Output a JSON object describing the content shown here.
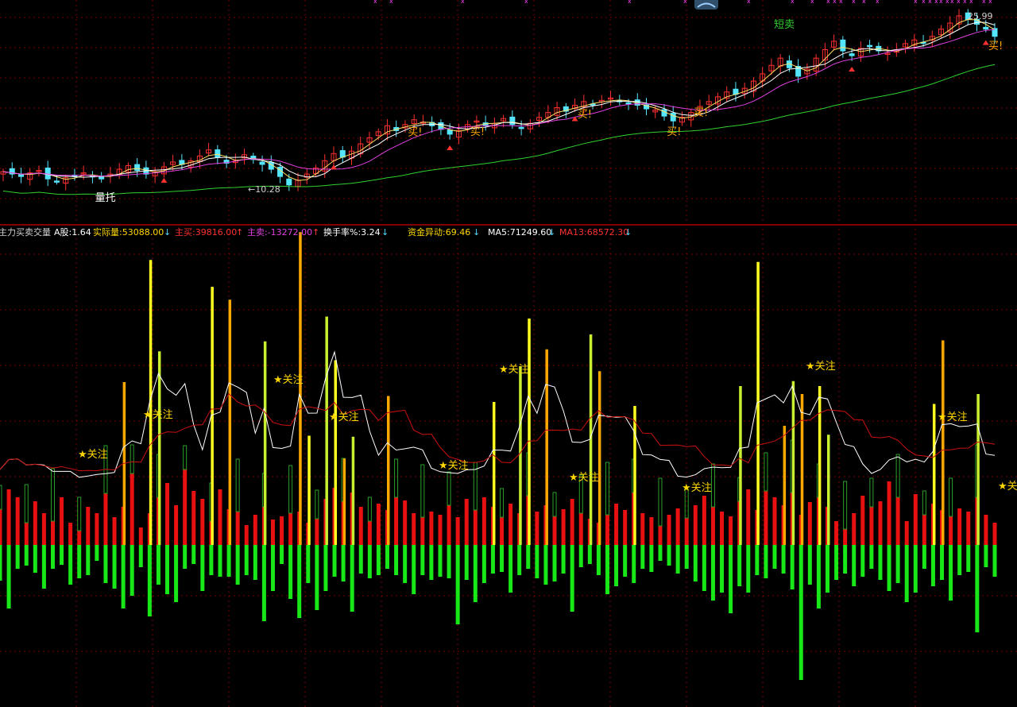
{
  "colors": {
    "background": "#000000",
    "grid": "#7a0000",
    "panel_border": "#b00000",
    "up_candle": "#ff3030",
    "down_candle": "#55e6ff",
    "ma_yellow": "#ffe066",
    "ma_white": "#ffffff",
    "ma_magenta": "#e040e0",
    "ma_green": "#30d030",
    "main_buy_red": "#e81010",
    "main_sell_green": "#18e818",
    "highlight_orange": "#ffa800",
    "highlight_yellow": "#ffff20",
    "highlight_green_yellow": "#c8f030",
    "signal_text": "#ffd700"
  },
  "top_panel": {
    "low_annotation": "←10.28",
    "high_annotation": "25.99",
    "labels": [
      {
        "text": "量托",
        "color": "#ffffff"
      },
      {
        "text": "买!",
        "color": "#ffa800"
      },
      {
        "text": "买!",
        "color": "#ffa800"
      },
      {
        "text": "买!",
        "color": "#ffa800"
      },
      {
        "text": "买!",
        "color": "#ffa800"
      },
      {
        "text": "买!",
        "color": "#ffa800"
      },
      {
        "text": "短卖",
        "color": "#30d030"
      },
      {
        "text": "买!",
        "color": "#ffa800"
      }
    ]
  },
  "indicator_bar": {
    "title": "主力买卖交量",
    "a_share": "A股:1.64",
    "actual_volume": "实际量:53088.00",
    "main_buy": "主买:39816.00",
    "main_sell": "主卖:-13272.00",
    "turnover": "换手率%:3.24",
    "capital_move": "资金异动:69.46",
    "ma5": "MA5:71249.60",
    "ma13": "MA13:68572.30"
  },
  "signal_label": "★关注",
  "chart_data": [
    {
      "type": "candlestick",
      "name": "price",
      "low_label": 10.28,
      "high_label": 25.99,
      "close": [
        13.0,
        12.8,
        12.6,
        12.9,
        13.1,
        12.4,
        12.2,
        12.5,
        12.7,
        12.9,
        12.6,
        12.4,
        12.8,
        13.2,
        13.5,
        13.1,
        12.8,
        13.0,
        13.4,
        13.8,
        13.6,
        13.9,
        14.3,
        14.8,
        14.2,
        13.7,
        13.9,
        14.4,
        14.0,
        13.6,
        13.2,
        12.6,
        11.9,
        12.3,
        12.8,
        13.3,
        13.9,
        14.5,
        14.2,
        14.7,
        15.3,
        15.8,
        16.3,
        16.8,
        16.4,
        16.9,
        17.3,
        17.1,
        16.8,
        16.5,
        16.1,
        16.4,
        16.9,
        17.2,
        16.8,
        17.0,
        17.4,
        16.9,
        16.6,
        17.0,
        17.5,
        17.9,
        18.3,
        18.0,
        18.5,
        18.8,
        18.6,
        18.9,
        19.1,
        18.8,
        18.7,
        18.5,
        18.2,
        18.1,
        17.6,
        17.2,
        17.5,
        17.9,
        18.4,
        18.8,
        19.2,
        19.6,
        19.4,
        19.9,
        20.5,
        21.1,
        21.8,
        22.4,
        21.6,
        20.9,
        21.5,
        22.4,
        23.1,
        23.8,
        23.0,
        22.6,
        23.2,
        23.4,
        23.0,
        22.8,
        23.1,
        23.6,
        23.9,
        23.7,
        24.2,
        24.8,
        25.3,
        25.9,
        25.6,
        25.2,
        24.8,
        24.2
      ],
      "ma_lines": [
        {
          "color": "#ffe066"
        },
        {
          "color": "#ffffff"
        },
        {
          "color": "#e040e0"
        },
        {
          "color": "#30d030"
        }
      ]
    },
    {
      "type": "bar",
      "name": "主力买卖交量",
      "main_buy": [
        45,
        70,
        60,
        28,
        55,
        40,
        30,
        60,
        28,
        18,
        48,
        40,
        65,
        35,
        48,
        90,
        22,
        40,
        60,
        78,
        50,
        95,
        68,
        58,
        30,
        70,
        45,
        42,
        25,
        38,
        48,
        32,
        36,
        40,
        42,
        28,
        33,
        58,
        72,
        55,
        66,
        48,
        30,
        52,
        44,
        60,
        56,
        40,
        35,
        42,
        38,
        50,
        35,
        58,
        44,
        60,
        48,
        35,
        52,
        40,
        62,
        42,
        50,
        36,
        45,
        58,
        40,
        33,
        28,
        38,
        52,
        44,
        66,
        40,
        35,
        24,
        38,
        46,
        34,
        50,
        62,
        48,
        42,
        36,
        55,
        70,
        44,
        68,
        60,
        50,
        66,
        38,
        54,
        60,
        48,
        30,
        20,
        40,
        62,
        48,
        55,
        80,
        60,
        30,
        64,
        38,
        52,
        44,
        36,
        46,
        42,
        60,
        38,
        28
      ],
      "main_sell": [
        -45,
        -80,
        -30,
        -26,
        -35,
        -55,
        -30,
        -25,
        -50,
        -42,
        -38,
        -20,
        -48,
        -55,
        -80,
        -64,
        -28,
        -90,
        -50,
        -62,
        -72,
        -30,
        -24,
        -58,
        -38,
        -40,
        -40,
        -50,
        -38,
        -44,
        -96,
        -58,
        -24,
        -68,
        -92,
        -48,
        -82,
        -58,
        -40,
        -46,
        -84,
        -36,
        -42,
        -38,
        -30,
        -38,
        -48,
        -62,
        -38,
        -44,
        -40,
        -42,
        -100,
        -44,
        -72,
        -48,
        -36,
        -34,
        -60,
        -38,
        -30,
        -42,
        -50,
        -46,
        -36,
        -84,
        -28,
        -24,
        -38,
        -62,
        -52,
        -40,
        -48,
        -30,
        -34,
        -20,
        -26,
        -36,
        -30,
        -46,
        -58,
        -70,
        -60,
        -86,
        -52,
        -60,
        -38,
        -42,
        -30,
        -36,
        -56,
        -170,
        -50,
        -80,
        -60,
        -44,
        -36,
        -52,
        -40,
        -30,
        -44,
        -58,
        -48,
        -72,
        -60,
        -30,
        -52,
        -44,
        -70,
        -38,
        -34,
        -110,
        -28,
        -40
      ],
      "highlight_values": [
        164,
        287,
        195,
        260,
        247,
        205,
        315,
        110,
        230,
        186,
        87,
        109,
        150,
        144,
        180,
        228,
        197,
        212,
        175,
        140,
        160,
        285,
        120,
        165,
        152,
        160,
        111,
        142,
        206,
        152
      ],
      "signals": 11,
      "lines": [
        {
          "name": "MA5",
          "color": "#ffffff",
          "value": 71249.6
        },
        {
          "name": "MA13",
          "color": "#cc1010",
          "value": 68572.3
        }
      ]
    }
  ]
}
